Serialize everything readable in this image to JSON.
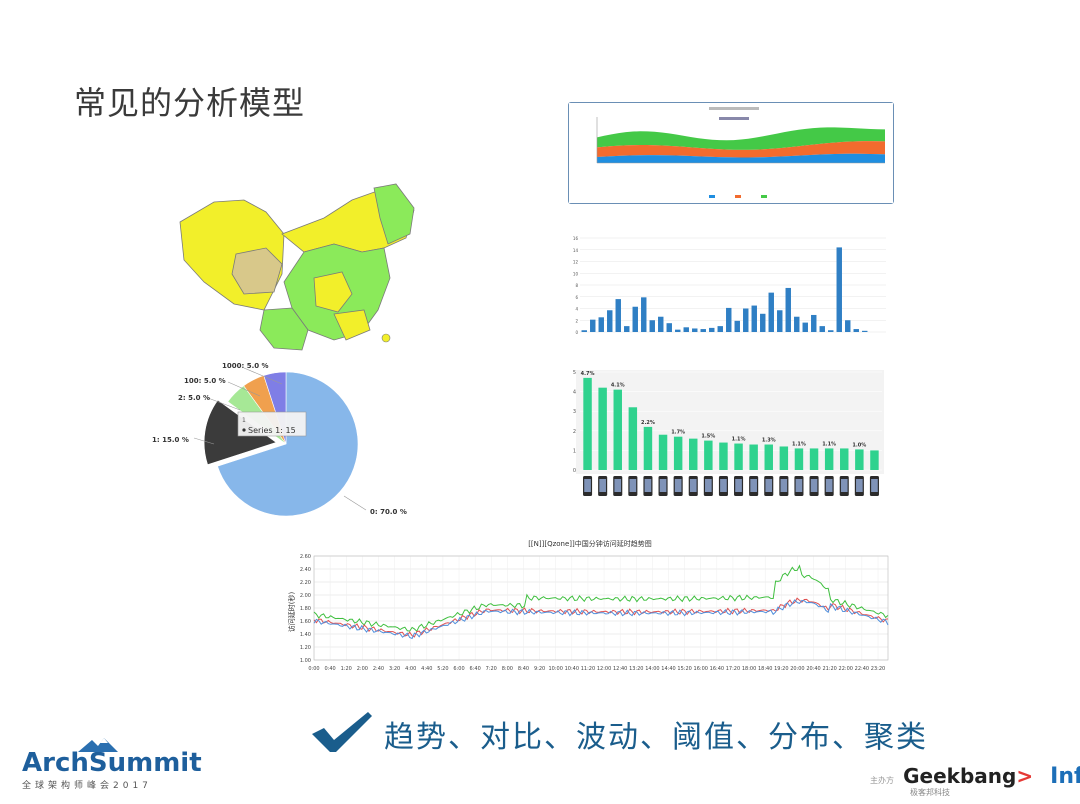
{
  "slide": {
    "title": "常见的分析模型",
    "caption": "趋势、对比、波动、阈值、分布、聚类"
  },
  "map_chart": {
    "colors": {
      "yellow": "#f2ef2a",
      "green": "#8bea5a",
      "tan": "#d8c88a",
      "border": "#7a7a7a"
    }
  },
  "pie_chart": {
    "labels": [
      "1000: 5.0 %",
      "100: 5.0 %",
      "2: 5.0 %",
      "1: 15.0 %",
      "0: 70.0 %"
    ],
    "tooltip_series": "Series 1: 15",
    "tooltip_index": "1",
    "colors": {
      "s0": "#87b7ea",
      "s1": "#3b3b3b",
      "s2": "#a6e896",
      "s3": "#f0a04e",
      "s4": "#7f7ee6"
    }
  },
  "area_chart": {
    "colors": {
      "a": "#1f8ee0",
      "b": "#f26b2e",
      "c": "#44c947"
    }
  },
  "bar_chart_1": {
    "yticks": [
      "16",
      "14",
      "12",
      "10",
      "8",
      "6",
      "4",
      "2",
      "0"
    ],
    "color": "#2f7fc4"
  },
  "bar_chart_2": {
    "yticks": [
      "5",
      "4",
      "3",
      "2",
      "1",
      "0"
    ],
    "labels": [
      "4.7%",
      "4.1%",
      "2.2%",
      "1.7%",
      "1.5%",
      "1.1%",
      "1.3%",
      "1.1%",
      "1.1%",
      "1.0%"
    ],
    "color": "#2fd28e"
  },
  "line_chart": {
    "title": "[[N]][Qzone]]中国分钟访问延时趋势图",
    "ylabel": "访问延时(秒)",
    "yticks": [
      "2.60",
      "2.40",
      "2.20",
      "2.00",
      "1.80",
      "1.60",
      "1.40",
      "1.20",
      "1.00"
    ],
    "xticks": [
      "0:00",
      "0:40",
      "1:20",
      "2:00",
      "2:40",
      "3:20",
      "4:00",
      "4:40",
      "5:20",
      "6:00",
      "6:40",
      "7:20",
      "8:00",
      "8:40",
      "9:20",
      "10:00",
      "10:40",
      "11:20",
      "12:00",
      "12:40",
      "13:20",
      "14:00",
      "14:40",
      "15:20",
      "16:00",
      "16:40",
      "17:20",
      "18:00",
      "18:40",
      "19:20",
      "20:00",
      "20:40",
      "21:20",
      "22:00",
      "22:40",
      "23:20"
    ],
    "colors": {
      "green": "#3fbf3f",
      "red": "#e05050",
      "blue": "#4f8fdc"
    }
  },
  "logos": {
    "left_main": "ArchSummit",
    "left_sub": "全球架构师峰会2017",
    "sponsor": "主办方",
    "geekbang": "Geekbang",
    "geekbang_sub": "极客邦科技",
    "infoq": "InfoQ"
  }
}
